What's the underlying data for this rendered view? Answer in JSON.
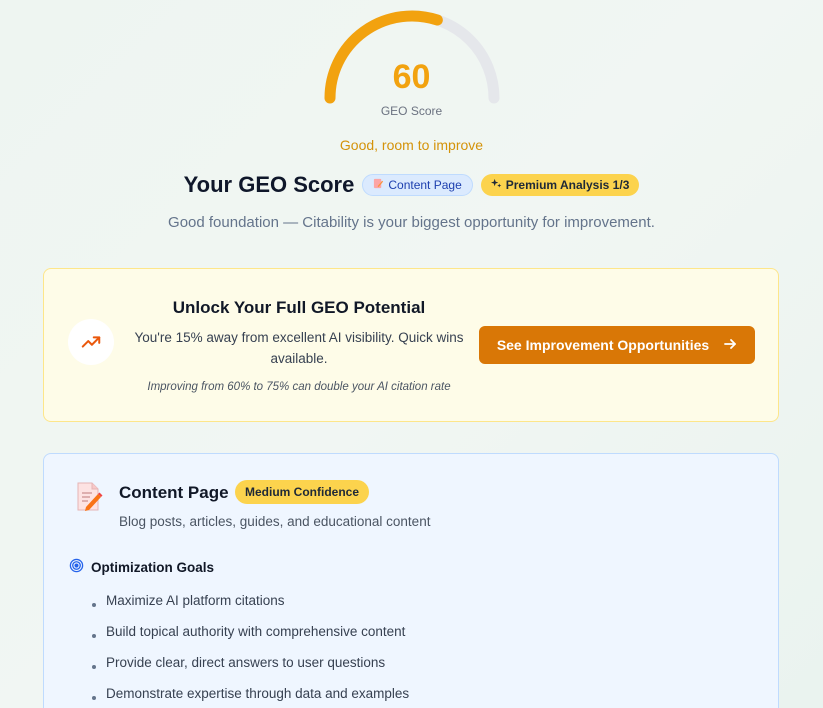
{
  "score": {
    "value": "60",
    "percent": 60,
    "caption": "GEO Score",
    "status": "Good, room to improve",
    "color": "#f2a20f"
  },
  "header": {
    "title": "Your GEO Score",
    "content_badge": {
      "icon": "document-edit-icon",
      "label": "Content Page"
    },
    "premium_badge": {
      "icon": "sparkles-icon",
      "label": "Premium Analysis 1/3"
    },
    "subtitle": "Good foundation — Citability is your biggest opportunity for improvement."
  },
  "unlock": {
    "icon": "trending-up-icon",
    "title": "Unlock Your Full GEO Potential",
    "body": "You're 15% away from excellent AI visibility. Quick wins available.",
    "note": "Improving from 60% to 75% can double your AI citation rate",
    "cta_label": "See Improvement Opportunities",
    "cta_icon": "arrow-right-icon",
    "accent": "#d97706"
  },
  "content_type": {
    "icon": "document-edit-icon",
    "title": "Content Page",
    "confidence": "Medium Confidence",
    "description": "Blog posts, articles, guides, and educational content",
    "goals_icon": "target-icon",
    "goals_title": "Optimization Goals",
    "goals": [
      "Maximize AI platform citations",
      "Build topical authority with comprehensive content",
      "Provide clear, direct answers to user questions",
      "Demonstrate expertise through data and examples"
    ]
  }
}
